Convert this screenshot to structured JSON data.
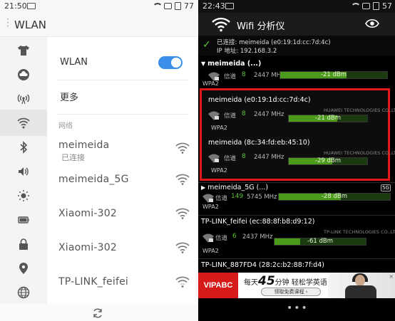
{
  "left": {
    "status": {
      "time": "21:50",
      "battery": "77"
    },
    "title": "WLAN",
    "wlan_label": "WLAN",
    "wlan_enabled": true,
    "more_label": "更多",
    "section_label": "网络",
    "networks": [
      {
        "name": "meimeida",
        "sub": "已连接"
      },
      {
        "name": "meimeida_5G",
        "sub": ""
      },
      {
        "name": "Xiaomi-302",
        "sub": ""
      },
      {
        "name": "Xiaomi-302",
        "sub": ""
      },
      {
        "name": "TP-LINK_feifei",
        "sub": ""
      }
    ],
    "sidebar_icons": [
      "shirt-icon",
      "cloud-icon",
      "hotspot-icon",
      "wifi-icon",
      "bluetooth-icon",
      "volume-icon",
      "brightness-icon",
      "battery-icon",
      "lock-icon",
      "location-icon",
      "globe-icon"
    ],
    "accent": "#3b8fe8"
  },
  "right": {
    "status": {
      "time": "22:43",
      "battery": "57"
    },
    "app_title": "Wifi 分析仪",
    "connected": {
      "line1": "已连接: meimeida (e0:19:1d:cc:7d:4c)",
      "line2": "IP 地址: 192.168.3.2"
    },
    "ch_label": "信道",
    "access_points": [
      {
        "header": "meimeida (...)",
        "collapsible": true,
        "channel": "8",
        "freq": "2447 MHz",
        "dbm": "-21 dBm",
        "level": 0.62,
        "vendor": "",
        "enc": "WPA2",
        "badge": ""
      },
      {
        "header": "meimeida (e0:19:1d:cc:7d:4c)",
        "collapsible": false,
        "channel": "8",
        "freq": "2447 MHz",
        "dbm": "-21 dBm",
        "level": 0.62,
        "vendor": "HUAWEI TECHNOLOGIES CO.,LTD",
        "enc": "WPA2",
        "badge": ""
      },
      {
        "header": "meimeida (8c:34:fd:eb:45:10)",
        "collapsible": false,
        "channel": "8",
        "freq": "2447 MHz",
        "dbm": "-29 dBm",
        "level": 0.55,
        "vendor": "HUAWEI TECHNOLOGIES CO.,LTD",
        "enc": "WPA2",
        "badge": ""
      },
      {
        "header": "meimeida_5G (...)",
        "collapsible": true,
        "channel": "149",
        "freq": "5745 MHz",
        "dbm": "-28 dBm",
        "level": 0.56,
        "vendor": "",
        "enc": "WPA2",
        "badge": "5G"
      },
      {
        "header": "TP-LINK_feifei (ec:88:8f:b8:d9:12)",
        "collapsible": false,
        "channel": "6",
        "freq": "2437 MHz",
        "dbm": "-61 dBm",
        "level": 0.28,
        "vendor": "TP-LINK TECHNOLOGIES CO.,LTD",
        "enc": "WPA2",
        "badge": ""
      },
      {
        "header": "TP-LINK_887FD4 (28:2c:b2:88:7f:d4)",
        "collapsible": false,
        "channel": "",
        "freq": "",
        "dbm": "",
        "level": 0,
        "vendor": "",
        "enc": "",
        "badge": ""
      }
    ],
    "ad": {
      "brand": "VIPABC",
      "pre": "每天",
      "big": "45",
      "post": "分钟 轻松学英语",
      "button": "领取免费课程 ›",
      "close": "×"
    },
    "nav_dots": "•••",
    "signal_color": "#4c9a1c",
    "highlight_color": "#e01818"
  }
}
